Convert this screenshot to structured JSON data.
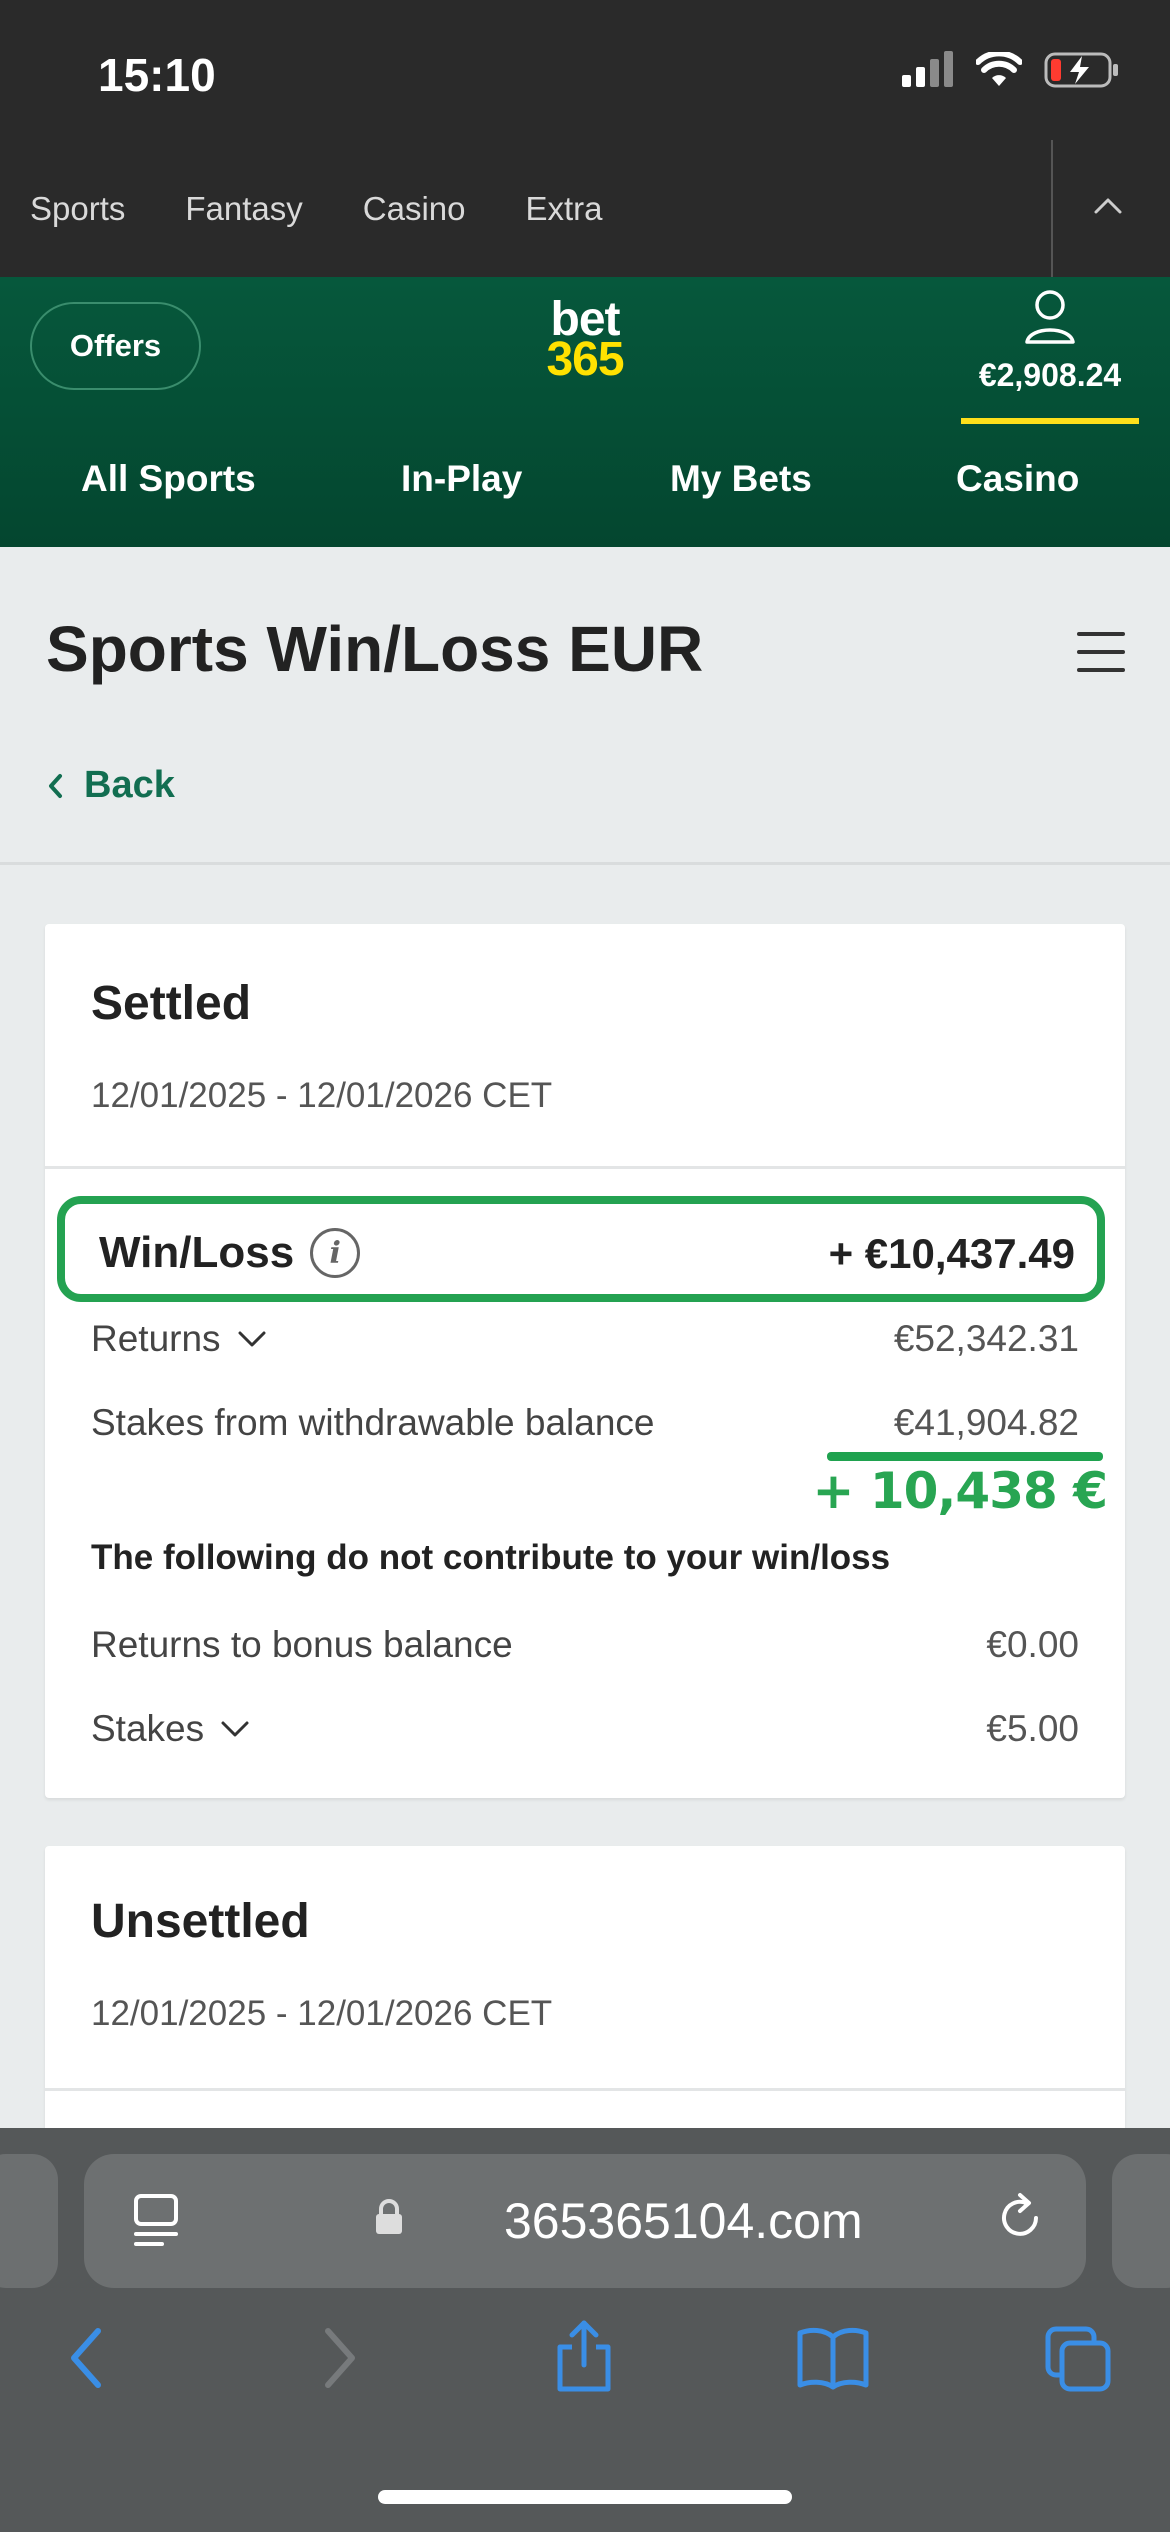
{
  "status_bar": {
    "time": "15:10"
  },
  "top_nav": {
    "items": [
      "Sports",
      "Fantasy",
      "Casino",
      "Extra"
    ]
  },
  "header": {
    "offers_label": "Offers",
    "logo_line1": "bet",
    "logo_line2": "365",
    "balance": "€2,908.24",
    "nav": [
      "All Sports",
      "In-Play",
      "My Bets",
      "Casino"
    ]
  },
  "page": {
    "title": "Sports Win/Loss EUR",
    "back_label": "Back"
  },
  "settled": {
    "title": "Settled",
    "date_range": "12/01/2025 - 12/01/2026 CET",
    "winloss_label": "Win/Loss",
    "winloss_value": "+ €10,437.49",
    "returns_label": "Returns",
    "returns_value": "€52,342.31",
    "stakes_withdrawable_label": "Stakes from withdrawable balance",
    "stakes_withdrawable_value": "€41,904.82",
    "handwritten_total": "+ 10,438 €",
    "note": "The following do not contribute to your win/loss",
    "bonus_returns_label": "Returns to bonus balance",
    "bonus_returns_value": "€0.00",
    "stakes_label": "Stakes",
    "stakes_value": "€5.00"
  },
  "unsettled": {
    "title": "Unsettled",
    "date_range": "12/01/2025 - 12/01/2026 CET"
  },
  "browser": {
    "url": "365365104.com"
  },
  "colors": {
    "brand_green": "#06583c",
    "brand_yellow": "#ffe100",
    "highlight_green": "#24a251",
    "link_green": "#126e51",
    "safari_blue": "#3a8ee6"
  }
}
